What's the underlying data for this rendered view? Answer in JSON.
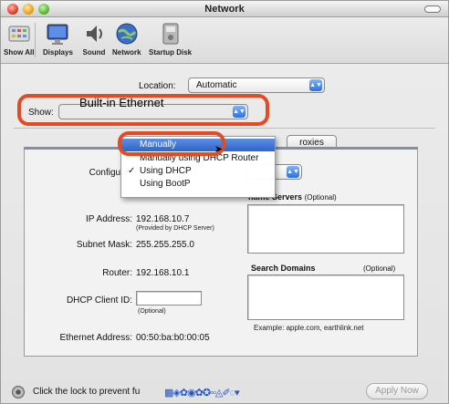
{
  "window": {
    "title": "Network"
  },
  "toolbar": {
    "show_all": "Show All",
    "displays": "Displays",
    "sound": "Sound",
    "network": "Network",
    "startup_disk": "Startup Disk"
  },
  "location": {
    "label": "Location:",
    "value": "Automatic"
  },
  "show": {
    "label": "Show:",
    "value": "Built-in Ethernet"
  },
  "tabs": {
    "proxies": "roxies"
  },
  "configure": {
    "label": "Configure",
    "menu_items": [
      "Manually",
      "Manually using DHCP Router",
      "Using DHCP",
      "Using BootP"
    ],
    "checked_item": "✓"
  },
  "fields": {
    "ip_label": "IP Address:",
    "ip_value": "192.168.10.7",
    "ip_note": "(Provided by DHCP Server)",
    "subnet_label": "Subnet Mask:",
    "subnet_value": "255.255.255.0",
    "router_label": "Router:",
    "router_value": "192.168.10.1",
    "dhcp_client_label": "DHCP Client ID:",
    "dhcp_client_note": "(Optional)",
    "ethernet_label": "Ethernet Address:",
    "ethernet_value": "00:50:ba:b0:00:05"
  },
  "dns": {
    "heading": "name Servers",
    "optional": "(Optional)"
  },
  "search_domains": {
    "heading": "Search Domains",
    "optional": "(Optional)",
    "example": "Example: apple.com, earthlink.net"
  },
  "footer": {
    "lock_text": "Click the lock to prevent fu",
    "apply_button": "Apply Now"
  },
  "colors": {
    "highlight_ring": "#e54b22",
    "menu_selection": "#3a6fd2"
  },
  "icons": [
    "show-all-icon",
    "displays-icon",
    "sound-icon",
    "network-icon",
    "startup-disk-icon",
    "lock-icon"
  ]
}
